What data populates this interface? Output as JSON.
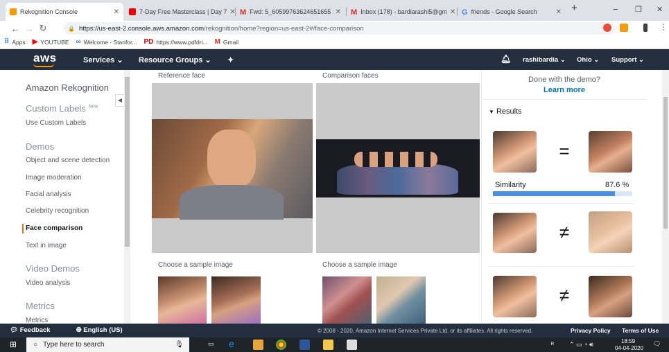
{
  "browser": {
    "tabs": [
      {
        "title": "Rekognition Console",
        "active": true,
        "fav": "#f90"
      },
      {
        "title": "7-Day Free Masterclass | Day 7",
        "active": false,
        "fav": "#e00"
      },
      {
        "title": "Fwd: 5_60599763624651655",
        "active": false,
        "fav": "#d93025"
      },
      {
        "title": "Inbox (178) - bardiarashi5@gm",
        "active": false,
        "fav": "#d93025"
      },
      {
        "title": "friends - Google Search",
        "active": false,
        "fav": "#4285f4"
      }
    ],
    "url_host": "https://us-east-2.console.aws.amazon.com",
    "url_rest": "/rekognition/home?region=us-east-2#/face-comparison",
    "bookmarks": [
      {
        "label": "Apps",
        "icon": "apps-icon",
        "color": "#4285f4"
      },
      {
        "label": "YOUTUBE",
        "icon": "youtube-icon",
        "color": "#e00"
      },
      {
        "label": "Welcome - Stanfor...",
        "icon": "coursera-icon",
        "color": "#2a73cc"
      },
      {
        "label": "https://www.pdfdri...",
        "icon": "pdf-icon",
        "color": "#c00"
      },
      {
        "label": "Gmail",
        "icon": "gmail-icon",
        "color": "#d93025"
      }
    ]
  },
  "aws": {
    "logo": "aws",
    "services": "Services",
    "resource_groups": "Resource Groups",
    "user": "rashibardia",
    "region": "Ohio",
    "support": "Support"
  },
  "sidebar": {
    "title": "Amazon Rekognition",
    "custom_labels": "Custom Labels",
    "new_badge": "New",
    "use_custom_labels": "Use Custom Labels",
    "demos": "Demos",
    "demo_items": [
      "Object and scene detection",
      "Image moderation",
      "Facial analysis",
      "Celebrity recognition",
      "Face comparison",
      "Text in image"
    ],
    "video_demos": "Video Demos",
    "video_analysis": "Video analysis",
    "metrics": "Metrics",
    "metrics_item": "Metrics"
  },
  "main": {
    "reference_label": "Reference face",
    "comparison_label": "Comparison faces",
    "sample_left": "Choose a sample image",
    "sample_right": "Choose a sample image"
  },
  "results": {
    "demo_q": "Done with the demo?",
    "learn_more": "Learn more",
    "heading": "Results",
    "similarity_label": "Similarity",
    "similarity_value": "87.6 %",
    "similarity_fraction": 0.876,
    "match_symbol": "=",
    "nomatch_symbol": "≠"
  },
  "footer": {
    "feedback": "Feedback",
    "language": "English (US)",
    "copyright": "© 2008 - 2020, Amazon Internet Services Private Ltd. or its affiliates. All rights reserved.",
    "privacy": "Privacy Policy",
    "terms": "Terms of Use"
  },
  "taskbar": {
    "search": "Type here to search",
    "time": "18:59",
    "date": "04-04-2020"
  }
}
